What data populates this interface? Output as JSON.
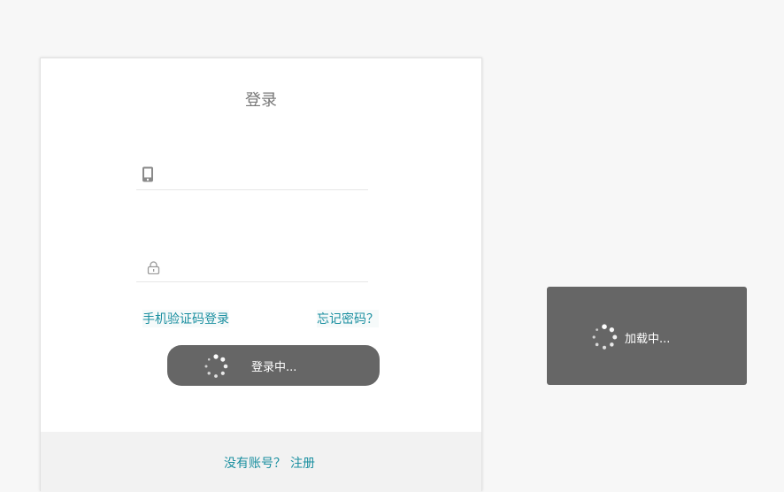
{
  "login_card": {
    "title": "登录",
    "phone_input": {
      "value": "",
      "placeholder": "",
      "icon": "mobile-phone-icon"
    },
    "password_input": {
      "value": "",
      "placeholder": "",
      "icon": "lock-icon"
    },
    "sms_login_link": "手机验证码登录",
    "forgot_password_link": "忘记密码？",
    "login_button": {
      "label": "登录中...",
      "icon": "loading-spinner-icon"
    },
    "footer": {
      "no_account_text": "没有账号？",
      "register_link": "注册"
    }
  },
  "loading_toast": {
    "label": "加载中...",
    "icon": "loading-spinner-icon"
  },
  "colors": {
    "background": "#f7f7f7",
    "card": "#ffffff",
    "link": "#1a8fa0",
    "button": "#666666",
    "toast": "#666666",
    "footer": "#f2f2f2"
  }
}
